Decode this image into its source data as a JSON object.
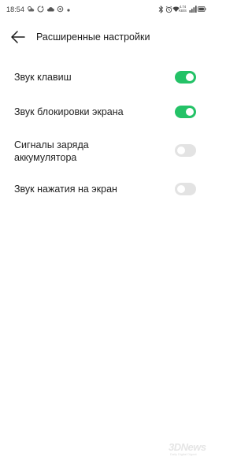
{
  "status_bar": {
    "time": "18:54",
    "net_speed": "4.74",
    "net_unit": "KB/S",
    "icons": [
      "weather-icon",
      "sync-icon",
      "cloud-icon",
      "vpn-icon",
      "dot-icon",
      "bluetooth-icon",
      "alarm-icon",
      "wifi-icon",
      "signal-icon",
      "battery-icon"
    ]
  },
  "header": {
    "title": "Расширенные настройки",
    "back_icon": "arrow-left-icon"
  },
  "settings": [
    {
      "label": "Звук клавиш",
      "enabled": true
    },
    {
      "label": "Звук блокировки экрана",
      "enabled": true
    },
    {
      "label": "Сигналы заряда аккумулятора",
      "enabled": false
    },
    {
      "label": "Звук нажатия на экран",
      "enabled": false
    }
  ],
  "colors": {
    "toggle_on": "#24c267",
    "toggle_off": "#e3e3e3",
    "background": "#ffffff"
  },
  "watermark": {
    "brand": "3DNews",
    "tagline": "Daily Digital Digest"
  }
}
